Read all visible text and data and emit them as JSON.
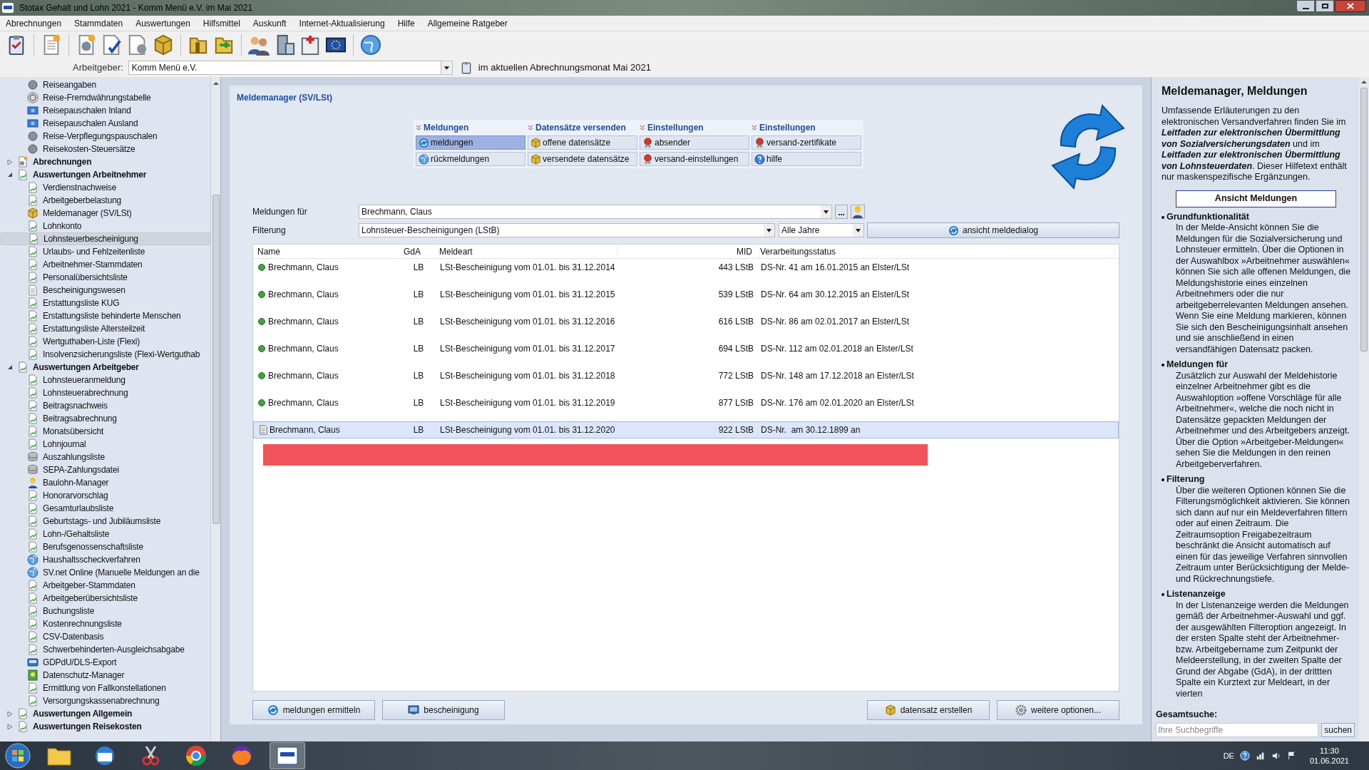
{
  "window": {
    "title": "Stotax Gehalt und Lohn 2021 - Komm Menü e.V. im Mai 2021"
  },
  "menu": [
    "Abrechnungen",
    "Stammdaten",
    "Auswertungen",
    "Hilfsmittel",
    "Auskunft",
    "Internet-Aktualisierung",
    "Hilfe",
    "Allgemeine Ratgeber"
  ],
  "employer": {
    "label": "Arbeitgeber:",
    "value": "Komm Menü e.V.",
    "note": "im aktuellen Abrechnungsmonat Mai 2021"
  },
  "sidebar": {
    "items": [
      {
        "label": "Reiseangaben",
        "kind": "radio",
        "selected": false
      },
      {
        "label": "Reise-Fremdwährungstabelle",
        "kind": "currency",
        "selected": false
      },
      {
        "label": "Reisepauschalen Inland",
        "kind": "card",
        "selected": false
      },
      {
        "label": "Reisepauschalen Ausland",
        "kind": "card",
        "selected": false
      },
      {
        "label": "Reise-Verpflegungspauschalen",
        "kind": "radio",
        "selected": false
      },
      {
        "label": "Reisekosten-Steuersätze",
        "kind": "radio",
        "selected": false
      }
    ],
    "groups": [
      {
        "label": "Abrechnungen",
        "kind": "settings",
        "expanded": false,
        "selected": false
      },
      {
        "label": "Auswertungen Arbeitnehmer",
        "kind": "report",
        "expanded": true,
        "selected": false,
        "children": [
          {
            "label": "Verdienstnachweise",
            "kind": "report",
            "selected": false
          },
          {
            "label": "Arbeitgeberbelastung",
            "kind": "report",
            "selected": false
          },
          {
            "label": "Meldemanager (SV/LSt)",
            "kind": "cube",
            "selected": false
          },
          {
            "label": "Lohnkonto",
            "kind": "report",
            "selected": false
          },
          {
            "label": "Lohnsteuerbescheinigung",
            "kind": "report",
            "selected": true
          },
          {
            "label": "Urlaubs- und Fehlzeitenliste",
            "kind": "report",
            "selected": false
          },
          {
            "label": "Arbeitnehmer-Stammdaten",
            "kind": "report",
            "selected": false
          },
          {
            "label": "Personalübersichtsliste",
            "kind": "report",
            "selected": false
          },
          {
            "label": "Bescheinigungswesen",
            "kind": "page",
            "selected": false
          },
          {
            "label": "Erstattungsliste KUG",
            "kind": "report",
            "selected": false
          },
          {
            "label": "Erstattungsliste behinderte Menschen",
            "kind": "report",
            "selected": false
          },
          {
            "label": "Erstattungsliste Altersteilzeit",
            "kind": "report",
            "selected": false
          },
          {
            "label": "Wertguthaben-Liste (Flexi)",
            "kind": "report",
            "selected": false
          },
          {
            "label": "Insolvenzsicherungsliste (Flexi-Wertguthab",
            "kind": "report",
            "selected": false
          }
        ]
      },
      {
        "label": "Auswertungen Arbeitgeber",
        "kind": "report",
        "expanded": true,
        "selected": false,
        "children": [
          {
            "label": "Lohnsteueranmeldung",
            "kind": "report",
            "selected": false
          },
          {
            "label": "Lohnsteuerabrechnung",
            "kind": "report",
            "selected": false
          },
          {
            "label": "Beitragsnachweis",
            "kind": "report",
            "selected": false
          },
          {
            "label": "Beitragsabrechnung",
            "kind": "report",
            "selected": false
          },
          {
            "label": "Monatsübersicht",
            "kind": "report",
            "selected": false
          },
          {
            "label": "Lohnjournal",
            "kind": "report",
            "selected": false
          },
          {
            "label": "Auszahlungsliste",
            "kind": "coins",
            "selected": false
          },
          {
            "label": "SEPA-Zahlungsdatei",
            "kind": "coins",
            "selected": false
          },
          {
            "label": "Baulohn-Manager",
            "kind": "worker",
            "selected": false
          },
          {
            "label": "Honorarvorschlag",
            "kind": "report",
            "selected": false
          },
          {
            "label": "Gesamturlaubsliste",
            "kind": "report",
            "selected": false
          },
          {
            "label": "Geburtstags- und Jubiläumsliste",
            "kind": "report",
            "selected": false
          },
          {
            "label": "Lohn-/Gehaltsliste",
            "kind": "report",
            "selected": false
          },
          {
            "label": "Berufsgenossenschaftsliste",
            "kind": "report",
            "selected": false
          },
          {
            "label": "Haushaltsscheckverfahren",
            "kind": "globe",
            "selected": false
          },
          {
            "label": "SV.net Online (Manuelle Meldungen an die",
            "kind": "globe",
            "selected": false
          },
          {
            "label": "Arbeitgeber-Stammdaten",
            "kind": "report",
            "selected": false
          },
          {
            "label": "Arbeitgeberübersichtsliste",
            "kind": "report",
            "selected": false
          },
          {
            "label": "Buchungsliste",
            "kind": "report",
            "selected": false
          },
          {
            "label": "Kostenrechnungsliste",
            "kind": "report",
            "selected": false
          },
          {
            "label": "CSV-Datenbasis",
            "kind": "report",
            "selected": false
          },
          {
            "label": "Schwerbehinderten-Ausgleichsabgabe",
            "kind": "report",
            "selected": false
          },
          {
            "label": "GDPdU/DLS-Export",
            "kind": "export",
            "selected": false
          },
          {
            "label": "Datenschutz-Manager",
            "kind": "shield",
            "selected": false
          },
          {
            "label": "Ermittlung von Fallkonstellationen",
            "kind": "report",
            "selected": false
          },
          {
            "label": "Versorgungskassenabrechnung",
            "kind": "report",
            "selected": false
          }
        ]
      },
      {
        "label": "Auswertungen Allgemein",
        "kind": "report",
        "expanded": false,
        "selected": false
      },
      {
        "label": "Auswertungen Reisekosten",
        "kind": "report",
        "expanded": false,
        "selected": false
      }
    ]
  },
  "main": {
    "title": "Meldemanager (SV/LSt)",
    "function_menu": [
      {
        "title": "Meldungen",
        "buttons": [
          {
            "label": "meldungen",
            "kind": "refresh",
            "selected": true
          },
          {
            "label": "rückmeldungen",
            "kind": "globe",
            "selected": false
          }
        ]
      },
      {
        "title": "Datensätze versenden",
        "buttons": [
          {
            "label": "offene datensätze",
            "kind": "cube",
            "selected": false
          },
          {
            "label": "versendete datensätze",
            "kind": "cube",
            "selected": false
          }
        ]
      },
      {
        "title": "Einstellungen",
        "buttons": [
          {
            "label": "absender",
            "kind": "seal",
            "selected": false
          },
          {
            "label": "versand-einstellungen",
            "kind": "seal",
            "selected": false
          }
        ]
      },
      {
        "title": "Einstellungen",
        "buttons": [
          {
            "label": "versand-zertifikate",
            "kind": "seal",
            "selected": false
          },
          {
            "label": "hilfe",
            "kind": "help",
            "selected": false
          }
        ]
      }
    ],
    "form": {
      "employee_label": "Meldungen für",
      "employee": "Brechmann, Claus",
      "filter_label": "Filterung",
      "filter": "Lohnsteuer-Bescheinigungen (LStB)",
      "period": "Alle Jahre",
      "view_button": "ansicht meldedialog"
    },
    "table": {
      "columns": [
        "Name",
        "GdA",
        "Meldeart",
        "MID",
        "Verarbeitungsstatus"
      ],
      "rows": [
        {
          "kind": "sent",
          "selected": false,
          "cells": [
            "Brechmann, Claus",
            "LB",
            "LSt-Bescheinigung vom 01.01. bis 31.12.2014",
            "443 LStB",
            "DS-Nr. 41 am 16.01.2015 an Elster/LSt"
          ]
        },
        {
          "kind": "sent",
          "selected": false,
          "cells": [
            "Brechmann, Claus",
            "LB",
            "LSt-Bescheinigung vom 01.01. bis 31.12.2015",
            "539 LStB",
            "DS-Nr. 64 am 30.12.2015 an Elster/LSt"
          ]
        },
        {
          "kind": "sent",
          "selected": false,
          "cells": [
            "Brechmann, Claus",
            "LB",
            "LSt-Bescheinigung vom 01.01. bis 31.12.2016",
            "616 LStB",
            "DS-Nr. 86 am 02.01.2017 an Elster/LSt"
          ]
        },
        {
          "kind": "sent",
          "selected": false,
          "cells": [
            "Brechmann, Claus",
            "LB",
            "LSt-Bescheinigung vom 01.01. bis 31.12.2017",
            "694 LStB",
            "DS-Nr. 112 am 02.01.2018 an Elster/LSt"
          ]
        },
        {
          "kind": "sent",
          "selected": false,
          "cells": [
            "Brechmann, Claus",
            "LB",
            "LSt-Bescheinigung vom 01.01. bis 31.12.2018",
            "772 LStB",
            "DS-Nr. 148 am 17.12.2018 an Elster/LSt"
          ]
        },
        {
          "kind": "sent",
          "selected": false,
          "cells": [
            "Brechmann, Claus",
            "LB",
            "LSt-Bescheinigung vom 01.01. bis 31.12.2019",
            "877 LStB",
            "DS-Nr. 176 am 02.01.2020 an Elster/LSt"
          ]
        },
        {
          "kind": "pending",
          "selected": true,
          "cells": [
            "Brechmann, Claus",
            "LB",
            "LSt-Bescheinigung vom 01.01. bis 31.12.2020",
            "922 LStB",
            "DS-Nr.  am 30.12.1899 an"
          ]
        }
      ]
    },
    "buttons_left": [
      {
        "label": "meldungen ermitteln",
        "kind": "refresh"
      },
      {
        "label": "bescheinigung",
        "kind": "monitor"
      }
    ],
    "buttons_right": [
      {
        "label": "datensatz erstellen",
        "kind": "cube"
      },
      {
        "label": "weitere optionen...",
        "kind": "gear"
      }
    ]
  },
  "help": {
    "title": "Meldemanager, Meldungen",
    "intro": "Umfassende Erläuterungen zu den elektronischen Versandverfahren finden Sie im **Leitfaden zur elektronischen Übermittlung von Sozialversicherungsdaten** und im **Leitfaden zur elektronischen Übermittlung von Lohnsteuerdaten**. Dieser Hilfetext enthält nur maskenspezifische Ergänzungen.",
    "button": "Ansicht Meldungen",
    "sections": [
      {
        "title": "Grundfunktionalität",
        "text": "In der Melde-Ansicht können Sie die Meldungen für die Sozialversicherung und Lohnsteuer ermitteln. Über die Optionen in der Auswahlbox »Arbeitnehmer auswählen« können Sie sich alle offenen Meldungen, die Meldungshistorie eines einzelnen Arbeitnehmers oder die nur arbeitgeberrelevanten Meldungen ansehen. Wenn Sie eine Meldung markieren, können Sie sich den Bescheinigungsinhalt ansehen und sie anschließend in einen versandfähigen Datensatz packen."
      },
      {
        "title": "Meldungen für",
        "text": "Zusätzlich zur Auswahl der Meldehistorie einzelner Arbeitnehmer gibt es die Auswahloption »offene Vorschläge für alle Arbeitnehmer«, welche die noch nicht in Datensätze gepackten Meldungen der Arbeitnehmer und des Arbeitgebers anzeigt. Über die Option »Arbeitgeber-Meldungen« sehen Sie die Meldungen in den reinen Arbeitgeberverfahren."
      },
      {
        "title": "Filterung",
        "text": "Über die weiteren Optionen können Sie die Filterungsmöglichkeit aktivieren. Sie können sich dann auf nur ein Meldeverfahren filtern oder auf einen Zeitraum. Die Zeitraumsoption Freigabezeitraum beschränkt die Ansicht automatisch auf einen für das jeweilige Verfahren sinnvollen Zeitraum unter Berücksichtigung der Melde- und Rückrechnungstiefe."
      },
      {
        "title": "Listenanzeige",
        "text": "In der Listenanzeige werden die Meldungen gemäß der Arbeitnehmer-Auswahl und ggf. der ausgewählten Filteroption angezeigt. In der ersten Spalte steht der Arbeitnehmer- bzw. Arbeitgebername zum Zeitpunkt der Meldeerstellung, in der zweiten Spalte der Grund der Abgabe (GdA), in der drittten Spalte ein Kurztext zur Meldeart, in der vierten"
      }
    ],
    "search": {
      "label": "Gesamtsuche:",
      "placeholder": "Ihre Suchbegriffe",
      "button": "suchen"
    }
  },
  "taskbar": {
    "language": "DE",
    "time": "11:30",
    "date": "01.06.2021"
  }
}
